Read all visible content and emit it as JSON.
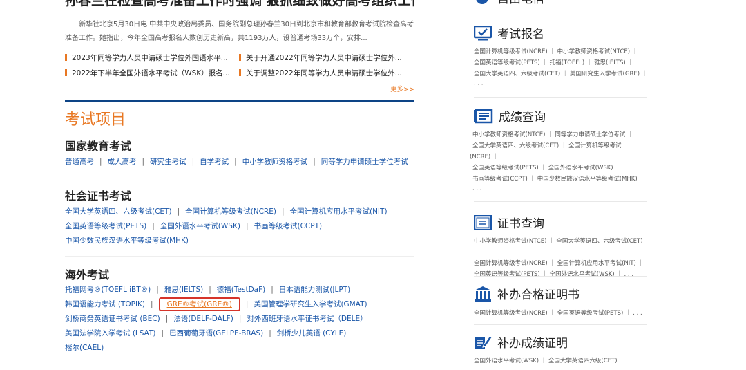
{
  "news": {
    "headline": "孙春兰在检查高考准备工作时强调 狠抓细致做好高考组织工作",
    "summary": "新华社北京5月30日电 中共中央政治局委员、国务院副总理孙春兰30日到北京市和教育部教育考试院检查高考准备工作。她指出，今年全国高考报名人数创历史新高，共1193万人，设普通考场33万个，安排...",
    "items": [
      "2023年同等学力人员申请硕士学位外国语水平...",
      "关于开通2022年同等学力人员申请硕士学位外...",
      "2022年下半年全国外语水平考试（WSK）报名...",
      "关于调整2022年同等学力人员申请硕士学位外..."
    ],
    "more": "更多>>"
  },
  "exams": {
    "title": "考试项目",
    "national": {
      "title": "国家教育考试",
      "links": [
        "普通高考",
        "成人高考",
        "研究生考试",
        "自学考试",
        "中小学教师资格考试",
        "同等学力申请硕士学位考试"
      ]
    },
    "social": {
      "title": "社会证书考试",
      "line1": [
        "全国大学英语四、六级考试(CET)",
        "全国计算机等级考试(NCRE)",
        "全国计算机应用水平考试(NIT)"
      ],
      "line2": [
        "全国英语等级考试(PETS)",
        "全国外语水平考试(WSK)",
        "书画等级考试(CCPT)"
      ],
      "line3": [
        "中国少数民族汉语水平等级考试(MHK)"
      ]
    },
    "overseas": {
      "title": "海外考试",
      "line1": [
        "托福网考®(TOEFL iBT®)",
        "雅思(IELTS)",
        "德福(TestDaF)",
        "日本语能力测试(JLPT)"
      ],
      "line2": [
        "韩国语能力考试 (TOPIK)",
        "GRE®考试(GRE®)",
        "美国管理学研究生入学考试(GMAT)"
      ],
      "line3": [
        "剑桥商务英语证书考试 (BEC)",
        "法语(DELF-DALF)",
        "对外西班牙语水平证书考试（DELE）"
      ],
      "line4": [
        "美国法学院入学考试 (LSAT)",
        "巴西葡萄牙语(GELPE-BRAS)",
        "剑桥少儿英语 (CYLE)"
      ],
      "line5": [
        "楷尔(CAEL)"
      ]
    }
  },
  "sidebar": {
    "top_partial": "自由电信",
    "registration": {
      "title": "考试报名",
      "lines": [
        "全国计算机等级考试(NCRE) ｜ 中小学教师资格考试(NTCE) ｜",
        "全国英语等级考试(PETS) ｜ 托福(TOEFL) ｜ 雅思(IELTS) ｜",
        "全国大学英语四、六级考试(CET) ｜ 美国研究生入学考试(GRE) ｜",
        "· · ·"
      ]
    },
    "scores": {
      "title": "成绩查询",
      "lines": [
        "中小学教师资格考试(NTCE) ｜ 同等学力申请硕士学位考试 ｜",
        "全国大学英语四、六级考试(CET) ｜ 全国计算机等级考试",
        "(NCRE) ｜",
        "全国英语等级考试(PETS) ｜ 全国外语水平考试(WSK) ｜",
        "书画等级考试(CCPT) ｜ 中国少数民族汉语水平等级考试(MHK) ｜",
        "· · ·"
      ]
    },
    "certificate": {
      "title": "证书查询",
      "lines": [
        "中小学教师资格考试(NTCE) ｜ 全国大学英语四、六级考试(CET) ｜",
        "全国计算机等级考试(NCRE) ｜ 全国计算机应用水平考试(NIT) ｜",
        "全国英语等级考试(PETS) ｜ 全国外语水平考试(WSK) ｜ . . ."
      ]
    },
    "reissue_cert": {
      "title": "补办合格证明书",
      "lines": [
        "全国计算机等级考试(NCRE) ｜ 全国英语等级考试(PETS) ｜ . . ."
      ]
    },
    "reissue_score": {
      "title": "补办成绩证明",
      "lines": [
        "全国外语水平考试(WSK) ｜ 全国大学英语四六级(CET) ｜"
      ]
    }
  },
  "colors": {
    "accent": "#e87722",
    "link": "#1a56a8",
    "navy": "#0d4486",
    "highlight": "#d6342a"
  }
}
